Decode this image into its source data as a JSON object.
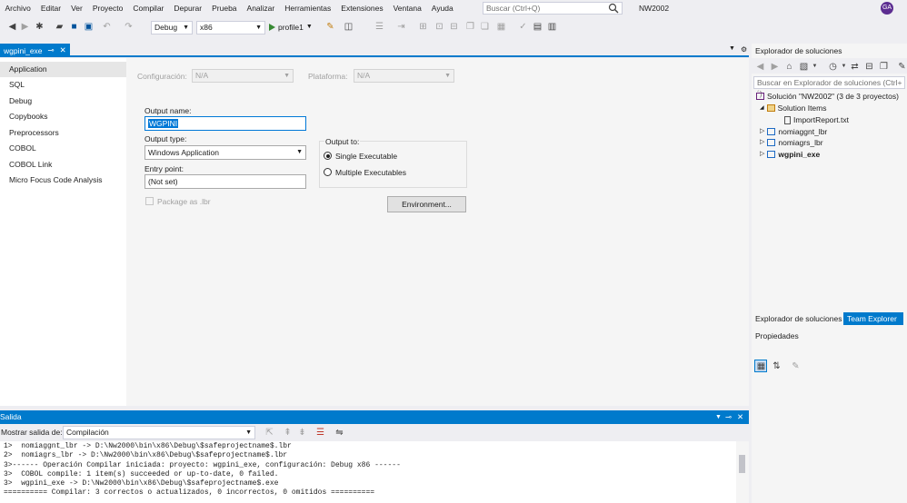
{
  "menu": [
    "Archivo",
    "Editar",
    "Ver",
    "Proyecto",
    "Compilar",
    "Depurar",
    "Prueba",
    "Analizar",
    "Herramientas",
    "Extensiones",
    "Ventana",
    "Ayuda"
  ],
  "search": {
    "placeholder": "Buscar (Ctrl+Q)"
  },
  "solution_name": "NW2002",
  "avatar_initials": "GA",
  "toolbar": {
    "config_combo": "Debug",
    "platform_combo": "x86",
    "start_label": "profile1"
  },
  "document_tab": {
    "label": "wgpini_exe",
    "pin": "⊸",
    "close": "✕"
  },
  "nav": {
    "items": [
      "Application",
      "SQL",
      "Debug",
      "Copybooks",
      "Preprocessors",
      "COBOL",
      "COBOL Link",
      "Micro Focus Code Analysis"
    ]
  },
  "page": {
    "configuration_label": "Configuración:",
    "configuration_value": "N/A",
    "platform_label": "Plataforma:",
    "platform_value": "N/A",
    "output_name_label": "Output name:",
    "output_name_value": "WGPINI",
    "output_type_label": "Output type:",
    "output_type_value": "Windows Application",
    "entry_point_label": "Entry point:",
    "entry_point_value": "(Not set)",
    "package_label": "Package as .lbr",
    "output_to_label": "Output to:",
    "single_exe_label": "Single Executable",
    "multiple_exe_label": "Multiple Executables",
    "environment_button": "Environment..."
  },
  "solution_explorer": {
    "title": "Explorador de soluciones",
    "search_placeholder": "Buscar en Explorador de soluciones (Ctrl+´)",
    "solution_label": "Solución \"NW2002\" (3 de 3 proyectos)",
    "solution_items": "Solution Items",
    "import_report": "ImportReport.txt",
    "project1": "nomiaggnt_lbr",
    "project2": "nomiagrs_lbr",
    "project3": "wgpini_exe",
    "tab_explorer": "Explorador de soluciones",
    "tab_team": "Team Explorer"
  },
  "properties": {
    "title": "Propiedades"
  },
  "output": {
    "title": "Salida",
    "show_from_label": "Mostrar salida de:",
    "show_from_value": "Compilación",
    "lines": [
      "1>  nomiaggnt_lbr -> D:\\Nw2000\\bin\\x86\\Debug\\$safeprojectname$.lbr",
      "2>  nomiagrs_lbr -> D:\\Nw2000\\bin\\x86\\Debug\\$safeprojectname$.lbr",
      "3>------ Operación Compilar iniciada: proyecto: wgpini_exe, configuración: Debug x86 ------",
      "3>  COBOL compile: 1 item(s) succeeded or up-to-date, 0 failed.",
      "3>  wgpini_exe -> D:\\Nw2000\\bin\\x86\\Debug\\$safeprojectname$.exe",
      "========== Compilar: 3 correctos o actualizados, 0 incorrectos, 0 omitidos =========="
    ]
  },
  "colors": {
    "accent": "#007acc",
    "background": "#eeeef2",
    "avatar": "#5c2d91"
  }
}
